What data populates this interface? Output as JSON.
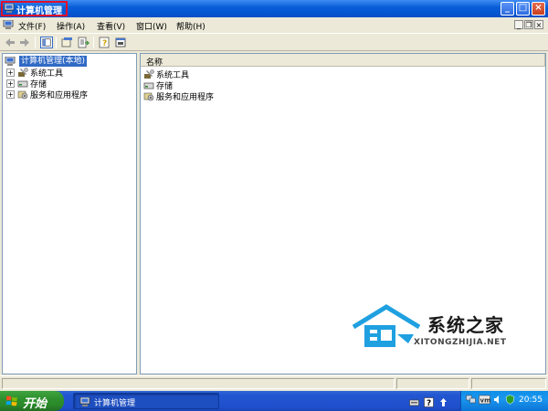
{
  "window": {
    "title": "计算机管理",
    "controls": {
      "minimize": "_",
      "maximize": "□",
      "close": "×"
    }
  },
  "menubar": {
    "items": [
      "文件(F)",
      "操作(A)",
      "查看(V)",
      "窗口(W)",
      "帮助(H)"
    ],
    "mdi_controls": {
      "minimize": "_",
      "restore": "❐",
      "close": "×"
    }
  },
  "toolbar": {
    "buttons": [
      "back-icon",
      "forward-icon",
      "show-hide-tree-icon",
      "properties-icon",
      "export-icon",
      "help-icon",
      "console-icon"
    ]
  },
  "tree": {
    "root": "计算机管理(本地)",
    "items": [
      {
        "label": "系统工具",
        "icon": "tools-icon",
        "expander": "+"
      },
      {
        "label": "存储",
        "icon": "storage-icon",
        "expander": "+"
      },
      {
        "label": "服务和应用程序",
        "icon": "services-icon",
        "expander": "+"
      }
    ]
  },
  "list": {
    "column": "名称",
    "items": [
      {
        "label": "系统工具",
        "icon": "tools-icon"
      },
      {
        "label": "存储",
        "icon": "storage-icon"
      },
      {
        "label": "服务和应用程序",
        "icon": "services-icon"
      }
    ]
  },
  "watermark": {
    "title": "系统之家",
    "subtitle": "XITONGZHIJIA.NET"
  },
  "taskbar": {
    "start_label": "开始",
    "task_label": "计算机管理",
    "clock": "20:55"
  }
}
